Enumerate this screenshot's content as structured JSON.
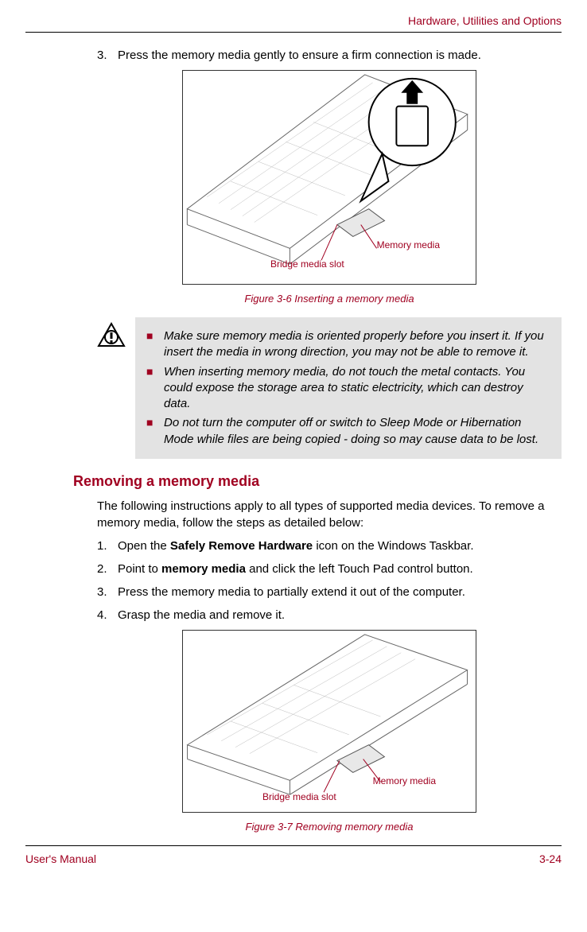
{
  "header": {
    "section_title": "Hardware, Utilities and Options"
  },
  "step3": {
    "num": "3.",
    "text": "Press the memory media gently to ensure a firm connection is made."
  },
  "figure1": {
    "label_memory": "Memory media",
    "label_slot": "Bridge media slot",
    "caption": "Figure 3-6 Inserting a memory media"
  },
  "caution": {
    "items": [
      "Make sure memory media is oriented properly before you insert it. If you insert the media in wrong direction, you may not be able to remove it.",
      "When inserting memory media, do not touch the metal contacts. You could expose the storage area to static electricity, which can destroy data.",
      "Do not turn the computer off or switch to Sleep Mode or Hibernation Mode while files are being copied - doing so may cause data to be lost."
    ]
  },
  "section2": {
    "heading": "Removing a memory media",
    "intro": "The following instructions apply to all types of supported media devices. To remove a memory media, follow the steps as detailed below:",
    "steps": [
      {
        "num": "1.",
        "pre": "Open the ",
        "bold": "Safely Remove Hardware",
        "post": " icon on the Windows Taskbar."
      },
      {
        "num": "2.",
        "pre": "Point to ",
        "bold": "memory media",
        "post": " and click the left Touch Pad control button."
      },
      {
        "num": "3.",
        "pre": "Press the memory media to partially extend it out of the computer.",
        "bold": "",
        "post": ""
      },
      {
        "num": "4.",
        "pre": "Grasp the media and remove it.",
        "bold": "",
        "post": ""
      }
    ]
  },
  "figure2": {
    "label_memory": "Memory media",
    "label_slot": "Bridge media slot",
    "caption": "Figure 3-7 Removing memory media"
  },
  "footer": {
    "left": "User's Manual",
    "right": "3-24"
  }
}
